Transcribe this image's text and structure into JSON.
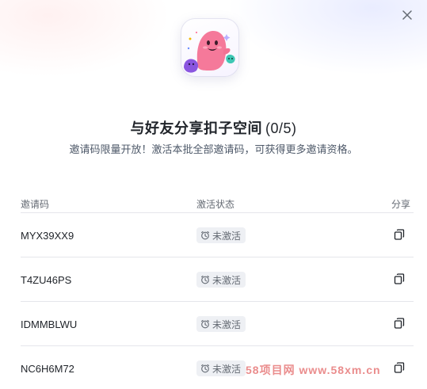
{
  "dialog": {
    "title": "与好友分享扣子空间",
    "count": "(0/5)",
    "subtitle": "邀请码限量开放！激活本批全部邀请码，可获得更多邀请资格。"
  },
  "table": {
    "headers": {
      "code": "邀请码",
      "status": "激活状态",
      "share": "分享"
    },
    "rows": [
      {
        "code": "MYX39XX9",
        "status": "未激活"
      },
      {
        "code": "T4ZU46PS",
        "status": "未激活"
      },
      {
        "code": "IDMMBLWU",
        "status": "未激活"
      },
      {
        "code": "NC6H6M72",
        "status": "未激活"
      }
    ]
  },
  "icons": {
    "close": "close-icon",
    "clock": "clock-icon",
    "copy": "copy-icon",
    "hero": "mascot-illustration"
  },
  "colors": {
    "title": "#1f2329",
    "subtitle": "#4e5969",
    "badge_bg": "#eef0f4",
    "divider": "#e5e6eb",
    "mascot_pink": "#f5799a",
    "mascot_teal": "#3ec7b4",
    "mascot_purple": "#8a55e0"
  },
  "watermark": "58项目网 www.58xm.cn"
}
